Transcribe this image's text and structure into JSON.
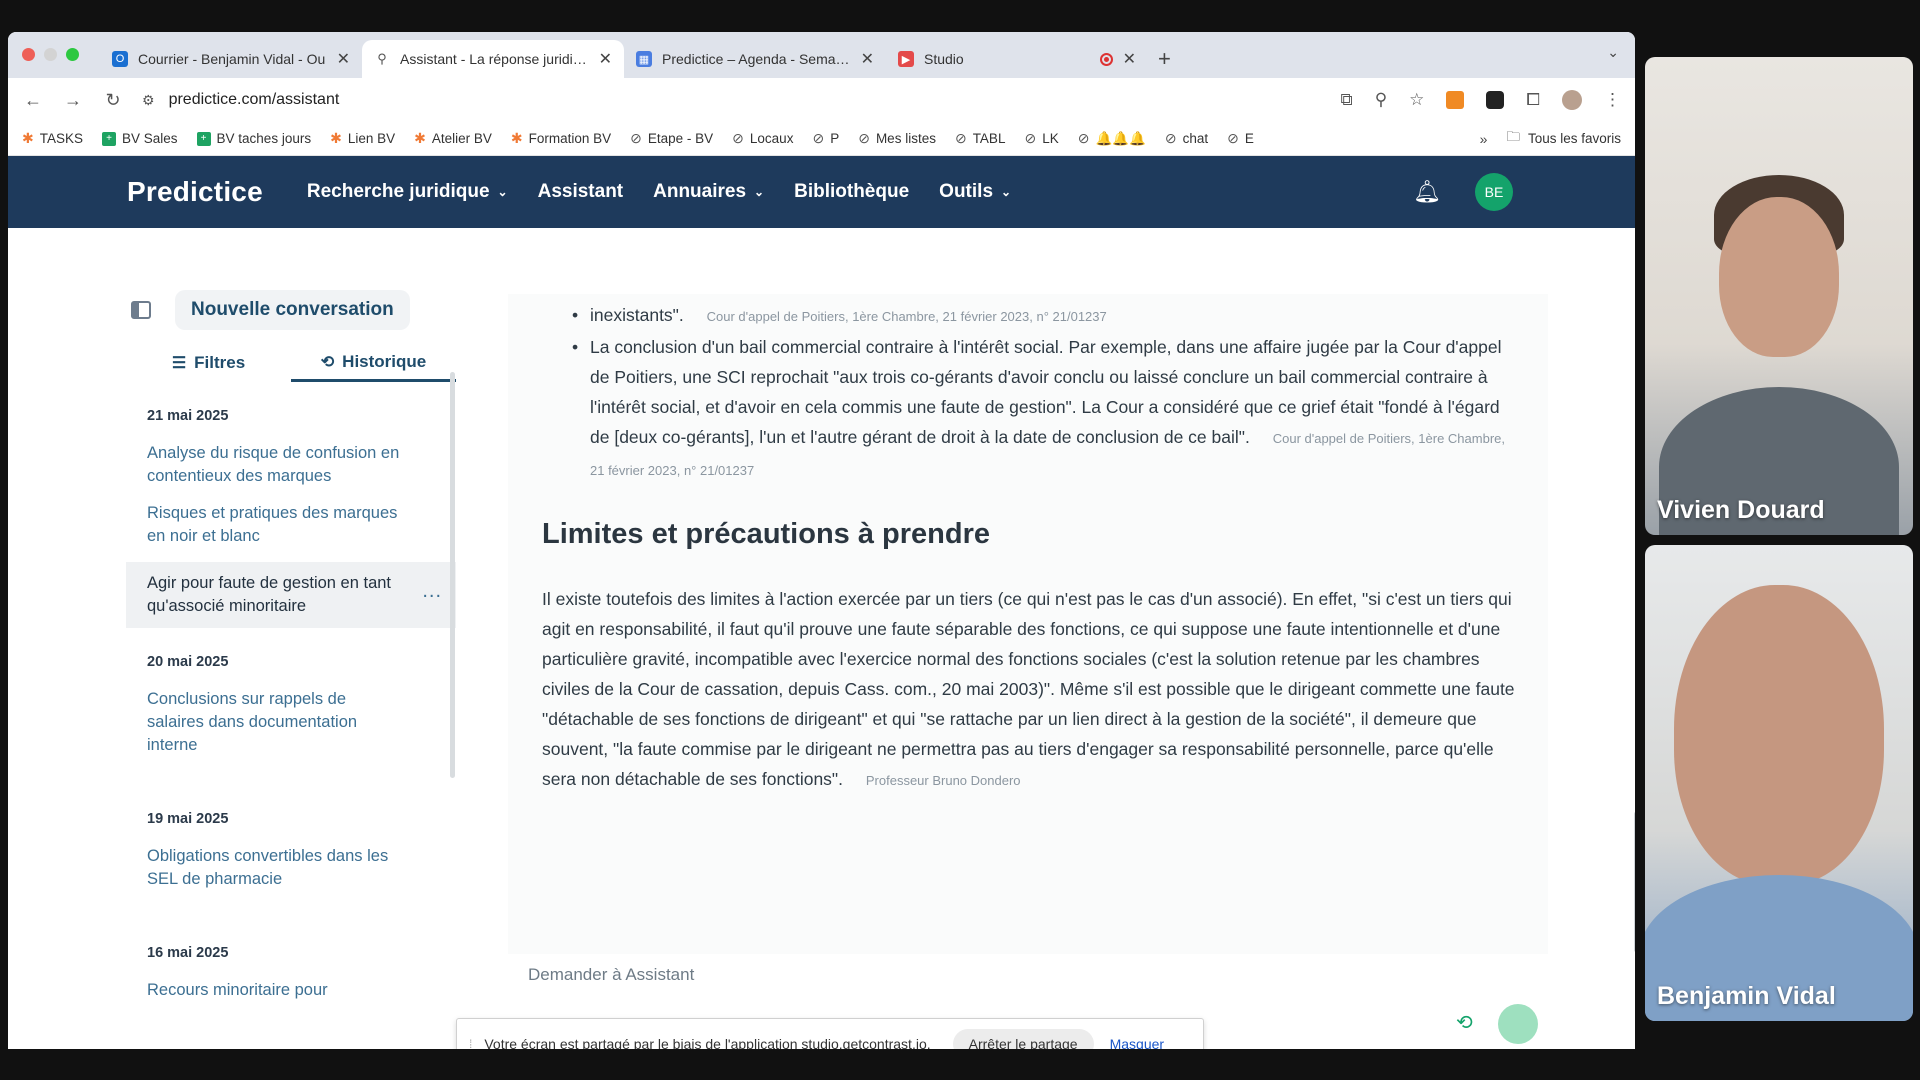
{
  "browser": {
    "tabs": [
      {
        "label": "Courrier - Benjamin Vidal - Ou",
        "icon": "outlook-icon",
        "active": false
      },
      {
        "label": "Assistant - La réponse juridique",
        "icon": "search-icon",
        "active": true
      },
      {
        "label": "Predictice – Agenda - Semaine",
        "icon": "calendar-icon",
        "active": false
      },
      {
        "label": "Studio",
        "icon": "studio-icon",
        "active": false
      }
    ],
    "url": "predictice.com/assistant",
    "bookmarks": [
      {
        "label": "TASKS",
        "icon": "hubspot-icon"
      },
      {
        "label": "BV Sales",
        "icon": "sheets-icon"
      },
      {
        "label": "BV taches jours",
        "icon": "sheets-icon"
      },
      {
        "label": "Lien BV",
        "icon": "hubspot-icon"
      },
      {
        "label": "Atelier BV",
        "icon": "hubspot-icon"
      },
      {
        "label": "Formation BV",
        "icon": "hubspot-icon"
      },
      {
        "label": "Etape - BV",
        "icon": "globe-icon"
      },
      {
        "label": "Locaux",
        "icon": "globe-icon"
      },
      {
        "label": "P",
        "icon": "globe-icon"
      },
      {
        "label": "Mes listes",
        "icon": "globe-icon"
      },
      {
        "label": "TABL",
        "icon": "globe-icon"
      },
      {
        "label": "LK",
        "icon": "globe-icon"
      },
      {
        "label": "🔔🔔🔔",
        "icon": "globe-icon"
      },
      {
        "label": "chat",
        "icon": "globe-icon"
      },
      {
        "label": "E",
        "icon": "globe-icon"
      }
    ],
    "bookmarks_more": "»",
    "all_bookmarks": "Tous les favoris"
  },
  "app": {
    "brand": "Predictice",
    "nav": [
      {
        "label": "Recherche juridique",
        "dropdown": true
      },
      {
        "label": "Assistant",
        "dropdown": false
      },
      {
        "label": "Annuaires",
        "dropdown": true
      },
      {
        "label": "Bibliothèque",
        "dropdown": false
      },
      {
        "label": "Outils",
        "dropdown": true
      }
    ],
    "user_initials": "BE"
  },
  "sidebar": {
    "new_conversation": "Nouvelle conversation",
    "tabs": [
      {
        "label": "Filtres",
        "active": false
      },
      {
        "label": "Historique",
        "active": true
      }
    ],
    "groups": [
      {
        "date": "21 mai 2025",
        "items": [
          {
            "label": "Analyse du risque de confusion en contentieux des marques"
          },
          {
            "label": "Risques et pratiques des marques en noir et blanc"
          },
          {
            "label": "Agir pour faute de gestion en tant qu'associé minoritaire",
            "selected": true
          }
        ]
      },
      {
        "date": "20 mai 2025",
        "items": [
          {
            "label": "Conclusions sur rappels de salaires dans documentation interne"
          }
        ]
      },
      {
        "date": "19 mai 2025",
        "items": [
          {
            "label": "Obligations convertibles dans les SEL de pharmacie"
          }
        ]
      },
      {
        "date": "16 mai 2025",
        "items": [
          {
            "label": "Recours minoritaire pour"
          }
        ]
      }
    ],
    "more_icon": "..."
  },
  "content": {
    "top_fragment": "inexistants\".",
    "top_citation": "Cour d'appel de Poitiers, 1ère Chambre, 21 février 2023, n° 21/01237",
    "bullet_text": "La conclusion d'un bail commercial contraire à l'intérêt social. Par exemple, dans une affaire jugée par la Cour d'appel de Poitiers, une SCI reprochait \"aux trois co-gérants d'avoir conclu ou laissé conclure un bail commercial contraire à l'intérêt social, et d'avoir en cela commis une faute de gestion\". La Cour a considéré que ce grief était \"fondé à l'égard de [deux co-gérants], l'un et l'autre gérant de droit à la date de conclusion de ce bail\".",
    "bullet_citation": "Cour d'appel de Poitiers, 1ère Chambre, 21 février 2023, n° 21/01237",
    "heading": "Limites et précautions à prendre",
    "paragraph": "Il existe toutefois des limites à l'action exercée par un tiers (ce qui n'est pas le cas d'un associé). En effet, \"si c'est un tiers qui agit en responsabilité, il faut qu'il prouve une faute séparable des fonctions, ce qui suppose une faute intentionnelle et d'une particulière gravité, incompatible avec l'exercice normal des fonctions sociales (c'est la solution retenue par les chambres civiles de la Cour de cassation, depuis Cass. com., 20 mai 2003)\". Même s'il est possible que le dirigeant commette une faute \"détachable de ses fonctions de dirigeant\" et qui \"se rattache par un lien direct à la gestion de la société\", il demeure que souvent, \"la faute commise par le dirigeant ne permettra pas au tiers d'engager sa responsabilité personnelle, parce qu'elle sera non détachable de ses fonctions\".",
    "paragraph_citation": "Professeur Bruno Dondero",
    "input_placeholder": "Demander à Assistant"
  },
  "share_banner": {
    "message": "Votre écran est partagé par le biais de l'application studio.getcontrast.io.",
    "stop_label": "Arrêter le partage",
    "hide_label": "Masquer"
  },
  "participants": [
    {
      "name": "Vivien Douard"
    },
    {
      "name": "Benjamin Vidal"
    }
  ],
  "colors": {
    "header_bg": "#1e3a5c",
    "accent_green": "#14a36b",
    "link_blue": "#3c6f92"
  }
}
